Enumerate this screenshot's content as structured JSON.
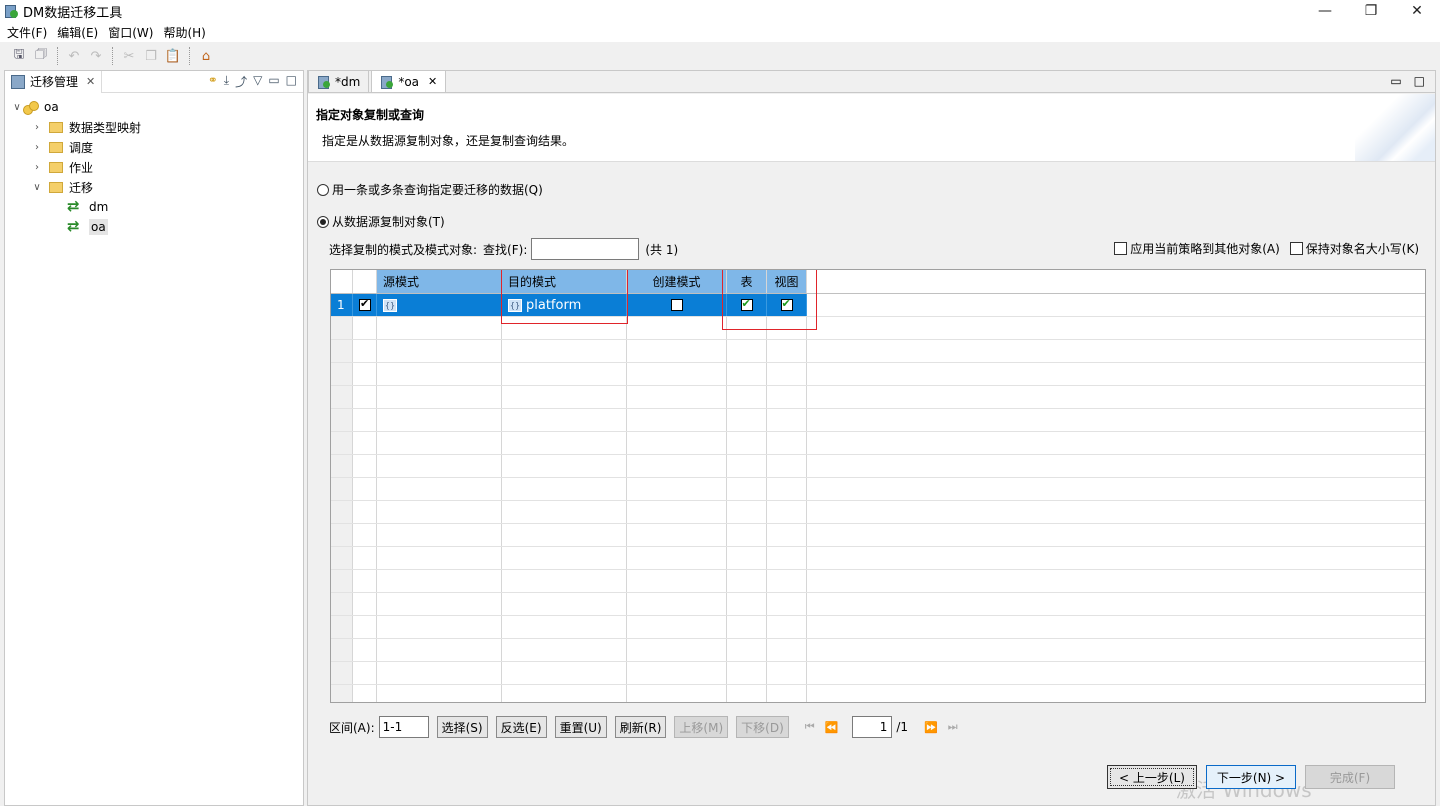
{
  "window": {
    "title": "DM数据迁移工具",
    "minimize": "—",
    "restore": "❐",
    "close": "✕"
  },
  "menu": [
    "文件(F)",
    "编辑(E)",
    "窗口(W)",
    "帮助(H)"
  ],
  "toolbar_icons": [
    "save-icon",
    "save-all-icon",
    "undo-icon",
    "redo-icon",
    "cut-icon",
    "copy-icon",
    "paste-icon",
    "home-icon"
  ],
  "left_panel": {
    "tab_label": "迁移管理",
    "tree": [
      {
        "label": "oa",
        "icon": "database-icon",
        "level": 0,
        "expanded": true
      },
      {
        "label": "数据类型映射",
        "icon": "folder-icon",
        "level": 1,
        "expanded": false
      },
      {
        "label": "调度",
        "icon": "folder-icon",
        "level": 1,
        "expanded": false
      },
      {
        "label": "作业",
        "icon": "folder-icon",
        "level": 1,
        "expanded": false
      },
      {
        "label": "迁移",
        "icon": "folder-icon",
        "level": 1,
        "expanded": true
      },
      {
        "label": "dm",
        "icon": "migration-icon",
        "level": 2
      },
      {
        "label": "oa",
        "icon": "migration-icon",
        "level": 2,
        "selected": true
      }
    ]
  },
  "editor_tabs": [
    {
      "label": "*dm",
      "active": false
    },
    {
      "label": "*oa",
      "active": true
    }
  ],
  "wizard": {
    "title": "指定对象复制或查询",
    "description": "指定是从数据源复制对象，还是复制查询结果。",
    "option_query": "用一条或多条查询指定要迁移的数据(Q)",
    "option_copy": "从数据源复制对象(T)",
    "selected_option": "copy",
    "filter_label": "选择复制的模式及模式对象:",
    "find_label": "查找(F):",
    "find_value": "",
    "count_label": "(共 1)",
    "apply_policy_label": "应用当前策略到其他对象(A)",
    "keep_case_label": "保持对象名大小写(K)"
  },
  "grid": {
    "headers": {
      "source_schema": "源模式",
      "target_schema": "目的模式",
      "create_schema": "创建模式",
      "table": "表",
      "view": "视图"
    },
    "rows": [
      {
        "num": "1",
        "checked": true,
        "source_schema": "",
        "target_schema": "platform",
        "create_schema": false,
        "table": true,
        "view": true
      }
    ],
    "schema_icon_glyph": "{}"
  },
  "bottom": {
    "range_label": "区间(A):",
    "range_value": "1-1",
    "select_label": "选择(S)",
    "invert_label": "反选(E)",
    "reset_label": "重置(U)",
    "refresh_label": "刷新(R)",
    "move_up_label": "上移(M)",
    "move_down_label": "下移(D)",
    "page_value": "1",
    "page_total": "/1"
  },
  "nav": {
    "back": "< 上一步(L)",
    "next": "下一步(N) >",
    "finish": "完成(F)"
  },
  "watermark": "激活 Windows"
}
